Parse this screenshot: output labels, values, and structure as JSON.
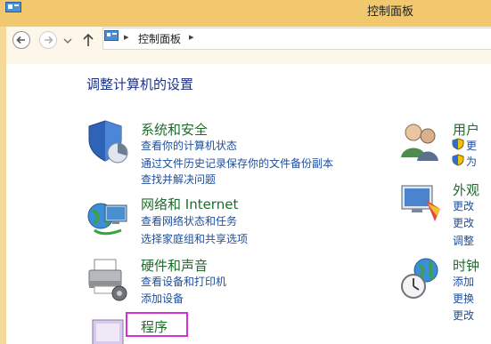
{
  "window": {
    "title": "控制面板"
  },
  "breadcrumb": {
    "label": "控制面板",
    "sep1": "▸",
    "sep2": "▸"
  },
  "main": {
    "heading": "调整计算机的设置"
  },
  "categories": [
    {
      "title": "系统和安全",
      "links": [
        "查看你的计算机状态",
        "通过文件历史记录保存你的文件备份副本",
        "查找并解决问题"
      ]
    },
    {
      "title": "网络和 Internet",
      "links": [
        "查看网络状态和任务",
        "选择家庭组和共享选项"
      ]
    },
    {
      "title": "硬件和声音",
      "links": [
        "查看设备和打印机",
        "添加设备"
      ]
    },
    {
      "title": "程序",
      "links": []
    },
    {
      "title": "用户",
      "links": [
        "更",
        "为"
      ]
    },
    {
      "title": "外观",
      "links": [
        "更改",
        "更改",
        "调整"
      ]
    },
    {
      "title": "时钟",
      "links": [
        "添加",
        "更换",
        "更改"
      ]
    }
  ],
  "colors": {
    "titlebar": "#f2c86e",
    "category_title": "#1d6c2c",
    "link": "#1f4e9c",
    "heading": "#1e3287",
    "highlight": "#d62fd6"
  }
}
